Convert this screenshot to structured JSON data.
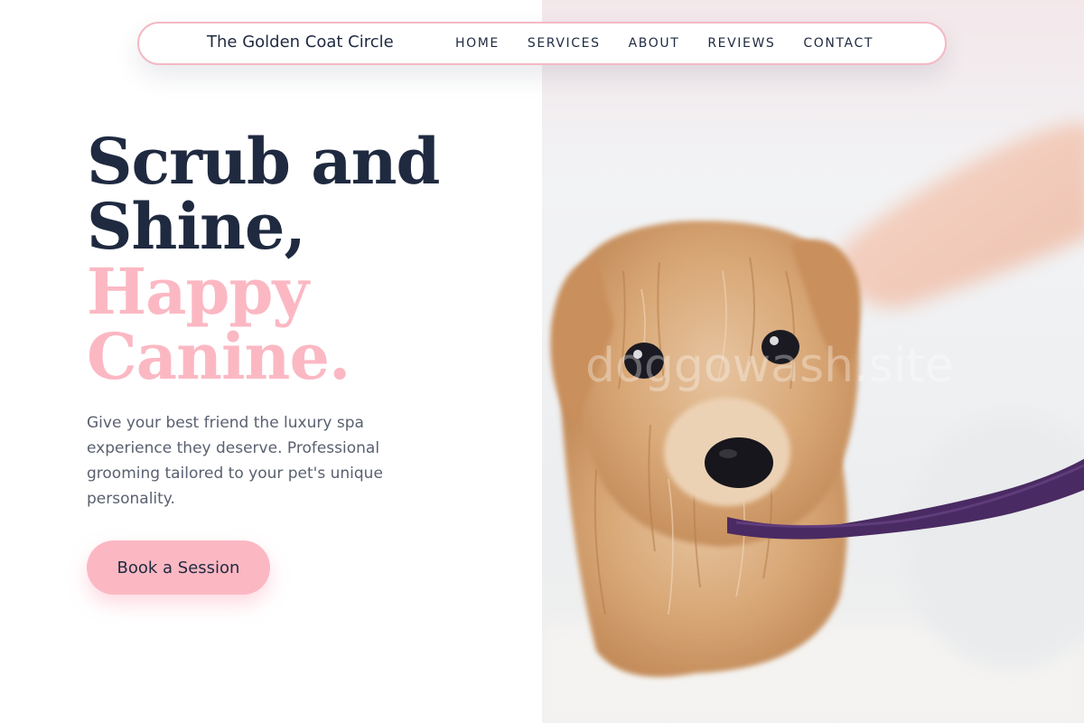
{
  "brand": {
    "name": "The Golden Coat Circle"
  },
  "nav": {
    "items": [
      {
        "label": "HOME"
      },
      {
        "label": "SERVICES"
      },
      {
        "label": "ABOUT"
      },
      {
        "label": "REVIEWS"
      },
      {
        "label": "CONTACT"
      }
    ]
  },
  "hero": {
    "headline_line_1": "Scrub and",
    "headline_line_2": "Shine,",
    "headline_line_3": "Happy",
    "headline_line_4": "Canine.",
    "description": "Give your best friend the luxury spa experience they deserve. Professional grooming tailored to your pet's unique personality.",
    "cta_label": "Book a Session",
    "watermark": "doggowash.site"
  },
  "colors": {
    "accent_pink": "#fbb8c3",
    "nav_border": "#f4b9c4",
    "headline_dark": "#1f2a40",
    "body_text": "#5a6070"
  }
}
